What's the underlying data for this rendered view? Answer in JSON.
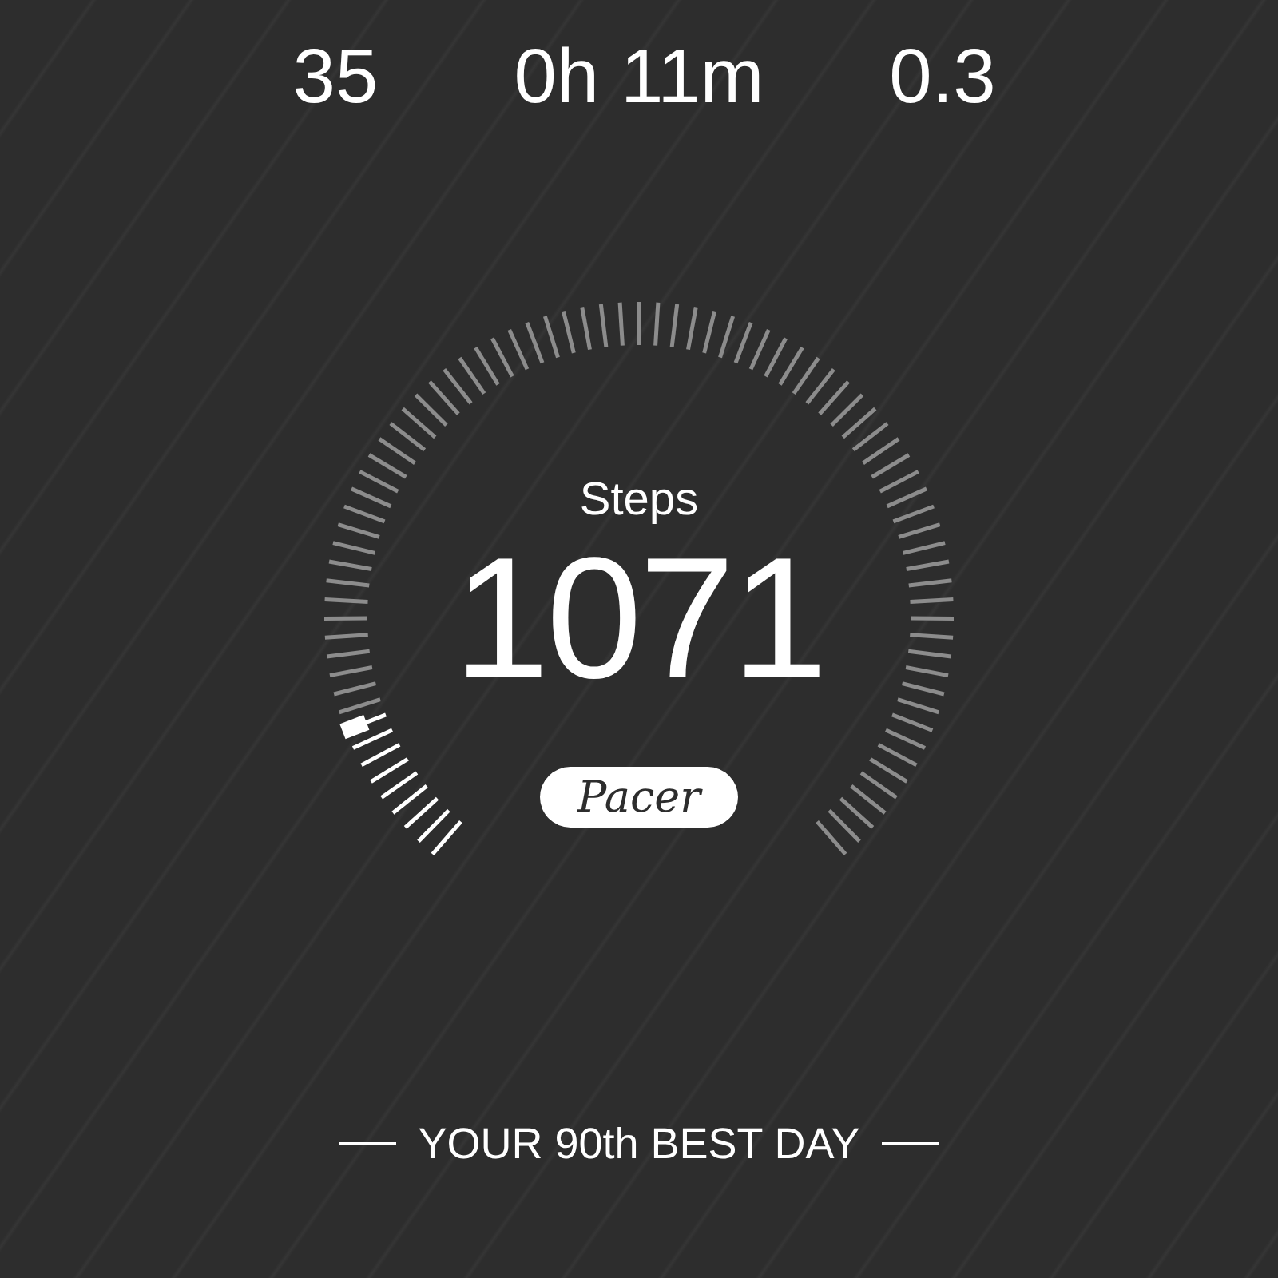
{
  "stats": [
    {
      "value": "35"
    },
    {
      "value": "0h 11m"
    },
    {
      "value": "0.3"
    }
  ],
  "gauge": {
    "label": "Steps",
    "value": "1071"
  },
  "badge": "Pacer",
  "footer": "YOUR 90th BEST DAY"
}
